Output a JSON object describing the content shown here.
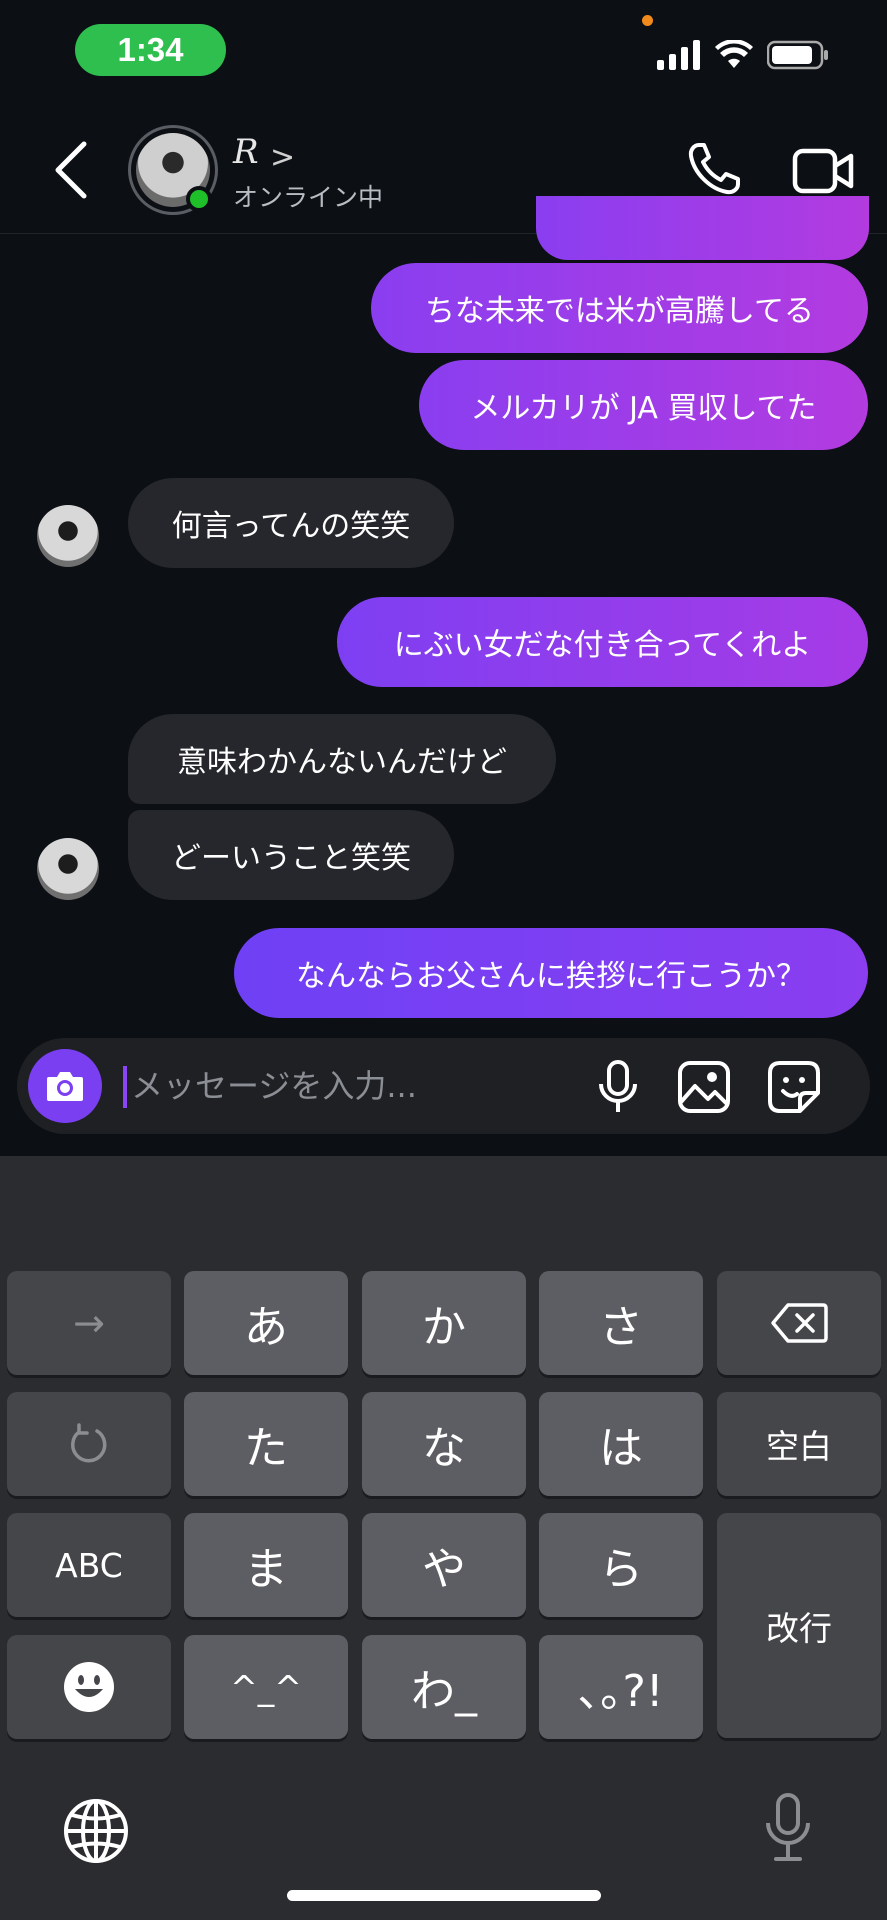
{
  "status_bar": {
    "time": "1:34"
  },
  "header": {
    "name": "R",
    "name_chevron": ">",
    "status": "オンライン中"
  },
  "messages": [
    {
      "side": "out",
      "text": "ちな未来では米が高騰してる"
    },
    {
      "side": "out",
      "text": "メルカリが JA 買収してた"
    },
    {
      "side": "in",
      "text": "何言ってんの笑笑"
    },
    {
      "side": "out",
      "text": "にぶい女だな付き合ってくれよ"
    },
    {
      "side": "in",
      "text": "意味わかんないんだけど"
    },
    {
      "side": "in",
      "text": "どーいうこと笑笑"
    },
    {
      "side": "out",
      "text": "なんならお父さんに挨拶に行こうか？"
    }
  ],
  "composer": {
    "placeholder": "メッセージを入力..."
  },
  "keyboard": {
    "arrow": "→",
    "a": "あ",
    "ka": "か",
    "sa": "さ",
    "ta": "た",
    "na": "な",
    "ha": "は",
    "ma": "ま",
    "ya": "や",
    "ra": "ら",
    "kao": "^_^",
    "wa": "わ_",
    "punct": "､｡?!",
    "space": "空白",
    "abc": "ABC",
    "enter": "改行"
  },
  "icons": {
    "back": "chevron-left-icon",
    "call": "phone-icon",
    "video": "video-icon",
    "camera": "camera-icon",
    "mic": "microphone-icon",
    "image": "image-icon",
    "sticker": "sticker-icon",
    "backspace": "backspace-icon",
    "undo": "undo-icon",
    "emoji": "emoji-icon",
    "globe": "globe-icon",
    "dictation": "dictation-mic-icon"
  },
  "colors": {
    "accent": "#7b3ff2",
    "online": "#1fbf2a",
    "time_pill": "#2fbf4f",
    "incoming_bubble": "#25272c"
  }
}
